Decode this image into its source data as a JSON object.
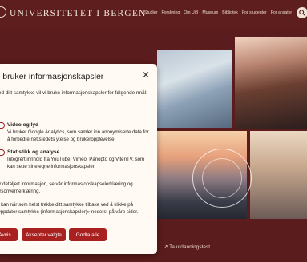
{
  "header": {
    "logo_text": "UNIVERSITETET I BERGEN",
    "nav": [
      "Studier",
      "Forskning",
      "Om UiB",
      "Museum",
      "Bibliotek",
      "For studenter",
      "For ansatte"
    ]
  },
  "background": {
    "link_text": "↗ Ta utdanningstest"
  },
  "dialog": {
    "title": "i bruker informasjonskapsler",
    "intro": "ed ditt samtykke vil vi bruke informasjonskapsler for følgende rmål:",
    "options": [
      {
        "title": "Video og lyd",
        "description": "Vi bruker Google Analytics, som samler inn anonymiserte data for å forbedre nettstedets ytelse og brukeropplevelse."
      },
      {
        "title": "Statistikk og analyse",
        "description": "Integrert innhold fra YouTube, Vimeo, Panopto og VitenTV, som kan sette sine egne informasjonskapsler."
      }
    ],
    "para1": "or detaljert informasjon, se vår informasjonskapselerklæring og ersonvernerklæring.",
    "para2": "u kan når som helst trekke ditt samtykke tilbake ved å klikke på Oppdater samtykke (informasjonskapsler)» nederst på våre sider.",
    "buttons": {
      "reject": "Avvis",
      "accept_selected": "Aksepter valgte",
      "accept_all": "Godta alle"
    }
  },
  "colors": {
    "brand": "#5e1e1e",
    "button": "#a8201f",
    "dialog_bg": "#fffaf4"
  }
}
